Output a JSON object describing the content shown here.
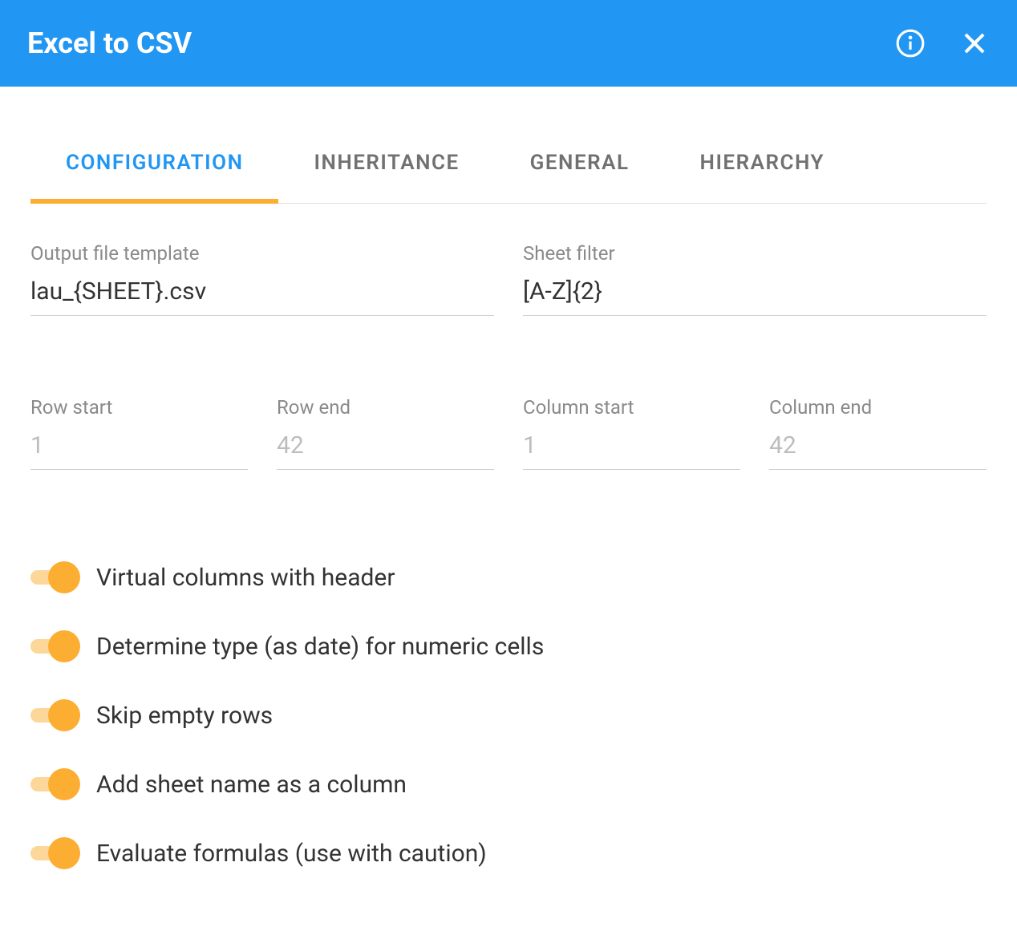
{
  "header": {
    "title": "Excel to CSV"
  },
  "tabs": {
    "configuration": "CONFIGURATION",
    "inheritance": "INHERITANCE",
    "general": "GENERAL",
    "hierarchy": "HIERARCHY"
  },
  "fields": {
    "output_template": {
      "label": "Output file template",
      "value": "lau_{SHEET}.csv"
    },
    "sheet_filter": {
      "label": "Sheet filter",
      "value": "[A-Z]{2}"
    },
    "row_start": {
      "label": "Row start",
      "placeholder": "1"
    },
    "row_end": {
      "label": "Row end",
      "placeholder": "42"
    },
    "column_start": {
      "label": "Column start",
      "placeholder": "1"
    },
    "column_end": {
      "label": "Column end",
      "placeholder": "42"
    }
  },
  "toggles": {
    "virtual_columns": "Virtual columns with header",
    "determine_type": "Determine type (as date) for numeric cells",
    "skip_empty": "Skip empty rows",
    "sheet_name_col": "Add sheet name as a column",
    "eval_formulas": "Evaluate formulas (use with caution)"
  }
}
